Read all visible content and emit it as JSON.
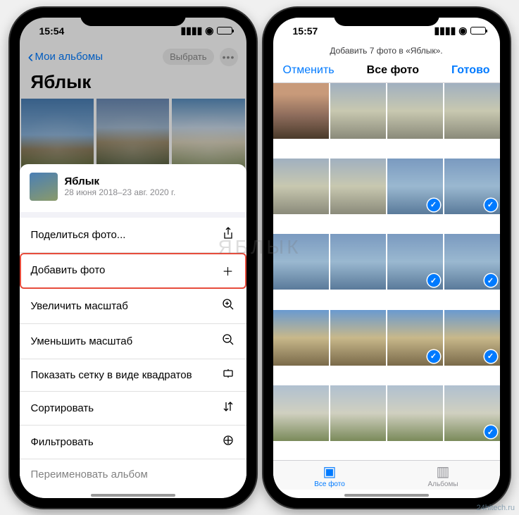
{
  "watermark_center": "ЯБЛЫК",
  "watermark_corner": "24hitech.ru",
  "left": {
    "status": {
      "time": "15:54"
    },
    "back_label": "Мои альбомы",
    "select_label": "Выбрать",
    "album_title": "Яблык",
    "sheet": {
      "title": "Яблык",
      "subtitle": "28 июня 2018–23 авг. 2020 г.",
      "items": [
        {
          "label": "Поделиться фото...",
          "icon": "share"
        },
        {
          "label": "Добавить фото",
          "icon": "plus",
          "highlight": true
        },
        {
          "label": "Увеличить масштаб",
          "icon": "zoom-in"
        },
        {
          "label": "Уменьшить масштаб",
          "icon": "zoom-out"
        },
        {
          "label": "Показать сетку в виде квадратов",
          "icon": "aspect"
        },
        {
          "label": "Сортировать",
          "icon": "sort"
        },
        {
          "label": "Фильтровать",
          "icon": "filter"
        },
        {
          "label": "Переименовать альбом",
          "icon": "rename"
        }
      ]
    }
  },
  "right": {
    "status": {
      "time": "15:57"
    },
    "header_note": "Добавить 7 фото в «Яблык».",
    "nav": {
      "cancel": "Отменить",
      "title": "Все фото",
      "done": "Готово"
    },
    "tabs": {
      "all": "Все фото",
      "albums": "Альбомы"
    },
    "selected_indices": [
      6,
      7,
      10,
      11,
      14,
      15,
      19
    ]
  }
}
